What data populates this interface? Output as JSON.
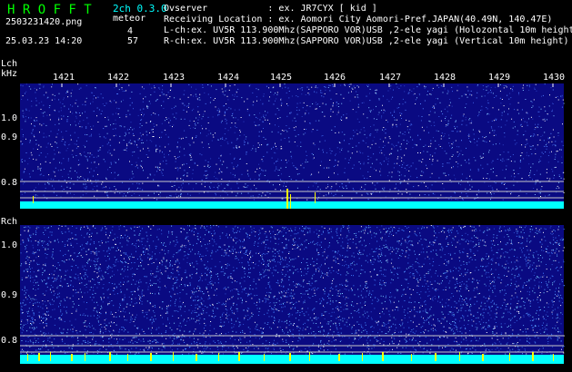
{
  "header": {
    "app_title": "H R O F F T",
    "version": "2ch 0.3.0",
    "filename": "2503231420.png",
    "datetime": "25.03.23 14:20",
    "meteor_label": "meteor",
    "meteor_count_l": "4",
    "meteor_count_r": "57"
  },
  "info": {
    "observer": "Ovserver           : ex. JR7CYX [ kid ]",
    "location": "Receiving Location : ex. Aomori City Aomori-Pref.JAPAN(40.49N, 140.47E)",
    "lch": "L-ch:ex. UV5R 113.900Mhz(SAPPORO VOR)USB ,2-ele yagi (Holozontal 10m height",
    "rch": "R-ch:ex. UV5R 113.900Mhz(SAPPORO VOR)USB ,2-ele yagi (Vertical 10m height)"
  },
  "lch_panel": {
    "channel_label": "Lch",
    "unit_label": "kHz",
    "freq_ticks": [
      "1421",
      "1422",
      "1423",
      "1424",
      "1425",
      "1426",
      "1427",
      "1428",
      "1429",
      "1430"
    ],
    "y_ticks": [
      "1.0",
      "0.9",
      "0.8"
    ]
  },
  "rch_panel": {
    "channel_label": "Rch",
    "y_ticks": [
      "1.0",
      "0.9",
      "0.8"
    ]
  },
  "colors": {
    "background": "#000000",
    "spectrogram_bg": "#0a0a82",
    "noise_floor": "#00ffff",
    "meteor_echo": "#ffff00",
    "title_green": "#00ff00",
    "version_cyan": "#00ffff"
  }
}
